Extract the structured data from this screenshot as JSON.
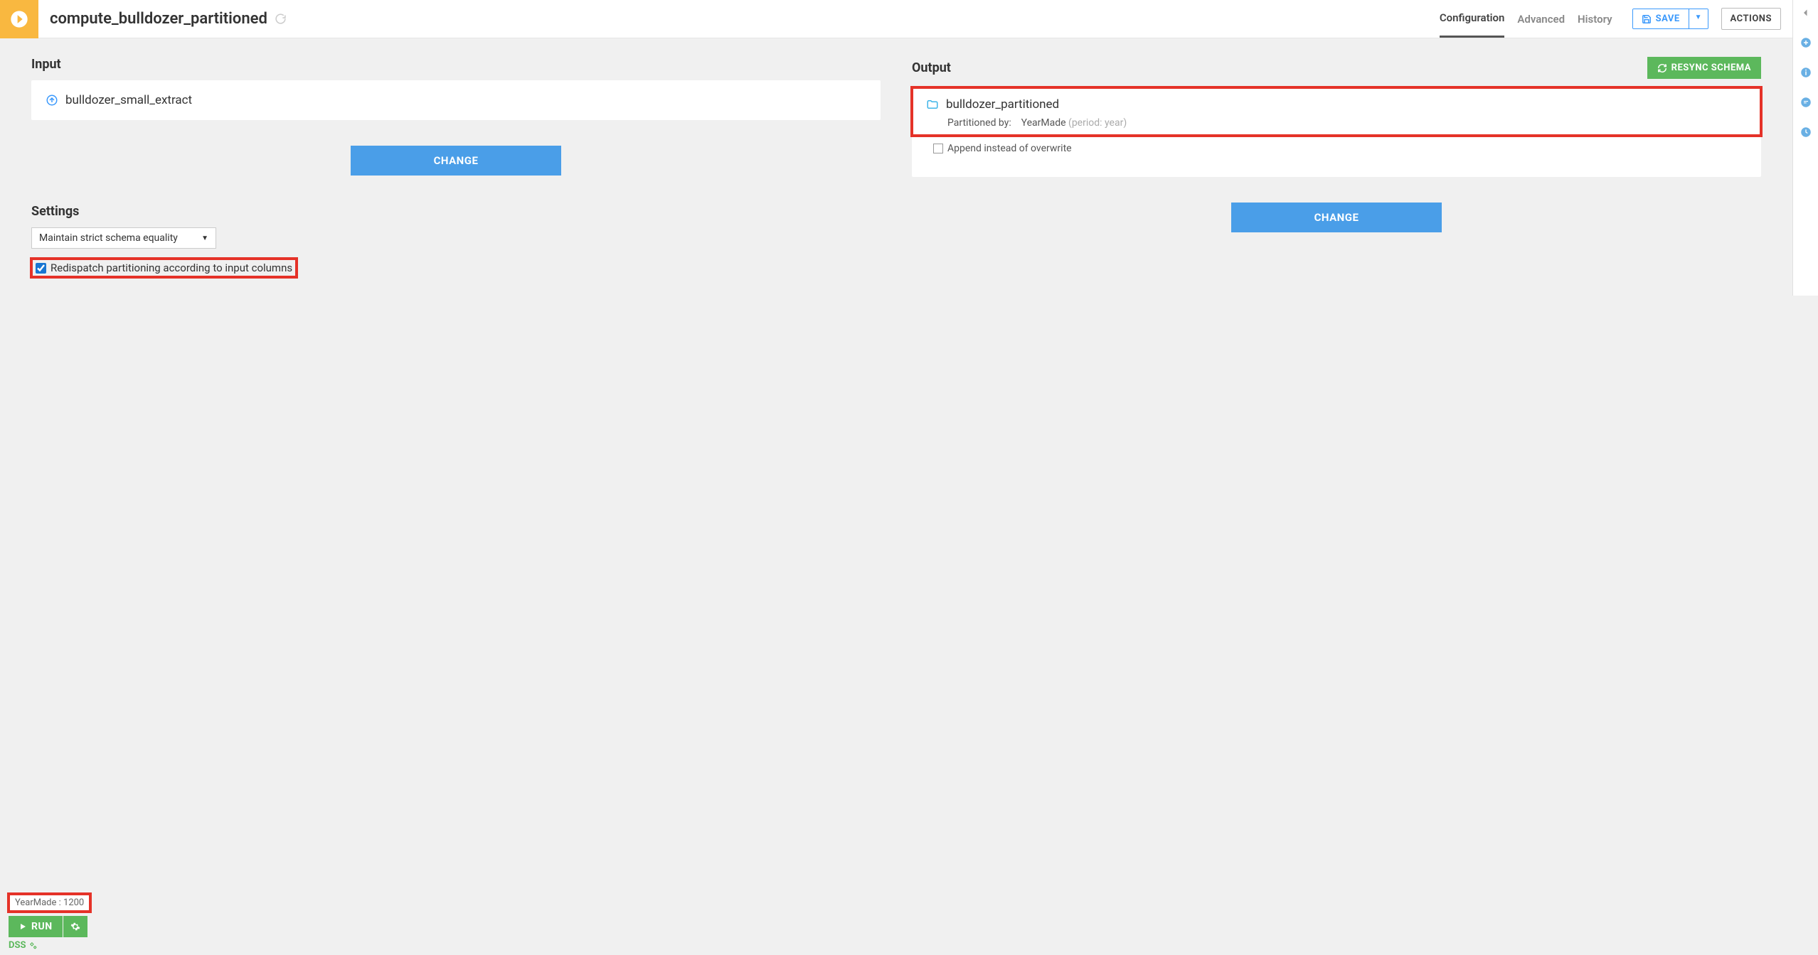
{
  "header": {
    "title": "compute_bulldozer_partitioned",
    "tabs": {
      "config": "Configuration",
      "advanced": "Advanced",
      "history": "History"
    },
    "save": "SAVE",
    "actions": "ACTIONS"
  },
  "input": {
    "title": "Input",
    "dataset": "bulldozer_small_extract",
    "change": "CHANGE"
  },
  "output": {
    "title": "Output",
    "resync": "RESYNC SCHEMA",
    "dataset": "bulldozer_partitioned",
    "partitionedByLabel": "Partitioned by:",
    "partitionedByValue": "YearMade",
    "partitionedByHint": "(period: year)",
    "appendLabel": "Append instead of overwrite",
    "change": "CHANGE"
  },
  "settings": {
    "title": "Settings",
    "schemaMode": "Maintain strict schema equality",
    "redispatch": "Redispatch partitioning according to input columns"
  },
  "footer": {
    "yearmade": "YearMade : 1200",
    "run": "RUN",
    "dss": "DSS"
  }
}
